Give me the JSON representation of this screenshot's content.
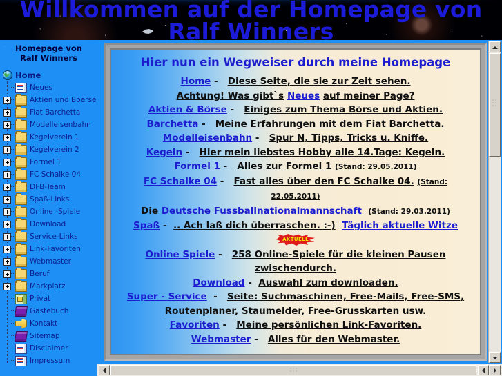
{
  "banner": {
    "title": "Willkommen auf der Homepage von Ralf Winners",
    "title_color": "#1b1bd8"
  },
  "sidebar": {
    "heading_line1": "Homepage von",
    "heading_line2": "Ralf Winners",
    "bg_color": "#1e90f5",
    "items": [
      {
        "label": "Home",
        "icon": "globe-icon",
        "expandable": false,
        "root": true
      },
      {
        "label": "Neues",
        "icon": "document-icon",
        "expandable": false
      },
      {
        "label": "Aktien und Boerse",
        "icon": "folder-icon",
        "expandable": true
      },
      {
        "label": "Fiat Barchetta",
        "icon": "folder-icon",
        "expandable": true
      },
      {
        "label": "Modelleisenbahn",
        "icon": "folder-icon",
        "expandable": true
      },
      {
        "label": "Kegelverein 1",
        "icon": "folder-icon",
        "expandable": true
      },
      {
        "label": "Kegelverein 2",
        "icon": "folder-icon",
        "expandable": true
      },
      {
        "label": "Formel 1",
        "icon": "folder-icon",
        "expandable": true
      },
      {
        "label": "FC Schalke 04",
        "icon": "folder-icon",
        "expandable": true
      },
      {
        "label": "DFB-Team",
        "icon": "folder-icon",
        "expandable": true
      },
      {
        "label": "Spaß-Links",
        "icon": "folder-icon",
        "expandable": true
      },
      {
        "label": "Online -Spiele",
        "icon": "folder-icon",
        "expandable": true
      },
      {
        "label": "Download",
        "icon": "folder-icon",
        "expandable": true
      },
      {
        "label": "Service-Links",
        "icon": "folder-icon",
        "expandable": true
      },
      {
        "label": "Link-Favoriten",
        "icon": "folder-icon",
        "expandable": true
      },
      {
        "label": "Webmaster",
        "icon": "folder-icon",
        "expandable": true
      },
      {
        "label": "Beruf",
        "icon": "folder-icon",
        "expandable": true
      },
      {
        "label": "Markplatz",
        "icon": "folder-icon",
        "expandable": true
      },
      {
        "label": "Privat",
        "icon": "privat-icon",
        "expandable": false
      },
      {
        "label": "Gästebuch",
        "icon": "book-icon",
        "expandable": false
      },
      {
        "label": "Kontakt",
        "icon": "key-icon",
        "expandable": false
      },
      {
        "label": "Sitemap",
        "icon": "book-icon",
        "expandable": false
      },
      {
        "label": "Disclaimer",
        "icon": "document-icon",
        "expandable": false
      },
      {
        "label": "Impressum",
        "icon": "document-icon",
        "expandable": false
      }
    ]
  },
  "content": {
    "heading": "Hier nun ein Wegweiser durch meine Homepage",
    "link_color": "#1d1dd0",
    "badge_label": "AKTUELL",
    "lines": [
      {
        "link": "Home",
        "sep": "-",
        "text": "Diese Seite, die sie zur Zeit sehen."
      },
      {
        "pre": "Achtung!   Was gibt`s",
        "link": "Neues",
        "post": "auf meiner Page?"
      },
      {
        "link": "Aktien & Börse",
        "sep": "-",
        "text": "Einiges zum Thema Börse und Aktien."
      },
      {
        "link": "Barchetta",
        "sep": "-",
        "text": "Meine Erfahrungen mit dem Fiat Barchetta."
      },
      {
        "link": "Modelleisenbahn",
        "sep": "-",
        "text": "Spur N, Tipps, Tricks u. Kniffe."
      },
      {
        "link": "Kegeln",
        "sep": "-",
        "text": "Hier mein liebstes Hobby alle 14.Tage: Kegeln."
      },
      {
        "link": "Formel 1",
        "sep": "-",
        "text": "Alles zur Formel 1",
        "stand": "(Stand: 29.05.2011)"
      },
      {
        "link": "FC Schalke 04",
        "sep": "-",
        "text": "Fast alles über den FC Schalke 04.",
        "stand": "(Stand: 22.05.2011)"
      },
      {
        "pre": "Die",
        "link": "Deutsche Fussballnationalmannschaft",
        "stand": "(Stand: 29.03.2011)"
      },
      {
        "link": "Spaß",
        "sep": "-",
        "text": ".. Ach laß dich überraschen. :-)",
        "link2": "Täglich aktuelle Witze"
      },
      {
        "badge": "AKTUELL"
      },
      {
        "link": "Online Spiele",
        "sep": "-",
        "text": "258 Online-Spiele für die kleinen Pausen zwischendurch."
      },
      {
        "link": "Download",
        "sep": "-",
        "text": "Auswahl zum downloaden."
      },
      {
        "link": "Super  -  Service",
        "sep": "-",
        "text": "Seite: Suchmaschinen, Free-Mails, Free-SMS,"
      },
      {
        "text": "Routenplaner, Staumelder, Free-Grusskarten usw."
      },
      {
        "link": "Favoriten",
        "sep": "-",
        "text": "Meine persönlichen Link-Favoriten."
      },
      {
        "link": "Webmaster",
        "sep": "-",
        "text": "Alles für den Webmaster."
      }
    ]
  },
  "scrollbars": {
    "vertical": {
      "up_arrow": "▲",
      "down_arrow": "▼"
    },
    "horizontal": {
      "left_arrow": "◄",
      "right_arrow": "►"
    }
  }
}
